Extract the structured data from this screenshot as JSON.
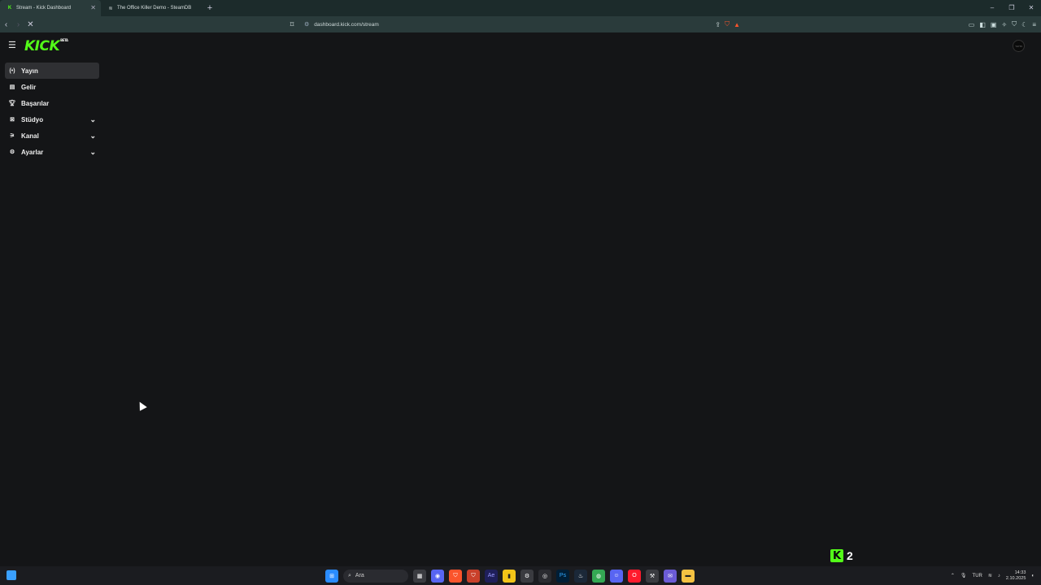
{
  "browser": {
    "tabs": [
      {
        "title": "Stream - Kick Dashboard",
        "favicon": "K"
      },
      {
        "title": "The Office Killer Demo - SteamDB",
        "favicon": "≋"
      }
    ],
    "url": "dashboard.kick.com/stream"
  },
  "header": {
    "logo": "KICK",
    "logo_badge": "BETA",
    "avatar_text": "YAYIN"
  },
  "sidebar": {
    "items": [
      {
        "label": "Yayın",
        "icon": "broadcast-icon"
      },
      {
        "label": "Gelir",
        "icon": "revenue-icon"
      },
      {
        "label": "Başarılar",
        "icon": "trophy-icon"
      },
      {
        "label": "Stüdyo",
        "icon": "studio-icon"
      },
      {
        "label": "Kanal",
        "icon": "channel-icon"
      },
      {
        "label": "Ayarlar",
        "icon": "gear-icon"
      }
    ]
  },
  "overlay": {
    "kick_letter": "K",
    "count": "2"
  },
  "taskbar": {
    "search_label": "Ara",
    "language": "TUR",
    "time": "14:33",
    "date": "2.10.2025"
  },
  "colors": {
    "accent": "#53fc18",
    "background": "#141517"
  }
}
